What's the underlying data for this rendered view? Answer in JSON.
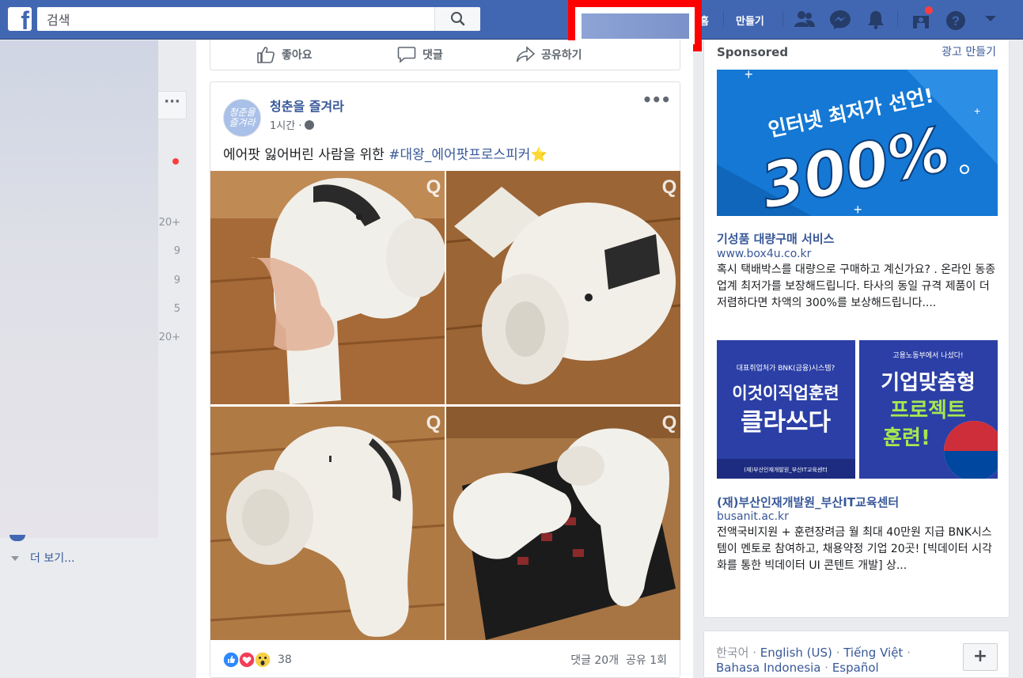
{
  "topbar": {
    "search_placeholder": "검색",
    "nav_home_partial": "홈",
    "nav_create": "만들기"
  },
  "left": {
    "counts": [
      "20+",
      "9",
      "9",
      "5",
      "20+"
    ],
    "see_more": "더 보기..."
  },
  "post_top_actions": {
    "like": "좋아요",
    "comment": "댓글",
    "share": "공유하기"
  },
  "post": {
    "page_name": "청춘을 즐겨라",
    "avatar_text": "청춘을 즐겨라",
    "time": "1시간 ·",
    "text_prefix": "에어팟 잃어버린 사람을 위한 ",
    "hashtag": "#대왕_에어팟프로스피커",
    "emoji": "⭐",
    "reaction_count": "38",
    "comments": "댓글 20개",
    "shares": "공유 1회"
  },
  "sidebar": {
    "sponsored": "Sponsored",
    "create_ad": "광고 만들기",
    "ad1": {
      "img_line1": "인터넷 최저가 선언!",
      "img_big": "300%",
      "title": "기성품 대량구매 서비스",
      "url": "www.box4u.co.kr",
      "desc": "혹시 택배박스를 대량으로 구매하고 계신가요? . 온라인 동종업계 최저가를 보장해드립니다. 타사의 동일 규격 제품이 더 저렴하다면 차액의 300%를 보상해드립니다...."
    },
    "ad2": {
      "imgA_top": "대표취업처가 BNK(금융)시스템?",
      "imgA_line1": "이것이직업훈련",
      "imgA_line2": "클라쓰다",
      "imgA_bottom": "(재)부산인재개발원_부산IT교육센터",
      "imgB_top": "고용노동부에서 나섰다!",
      "imgB_line1": "기업맞춤형",
      "imgB_line2": "프로젝트",
      "imgB_line3": "훈련!",
      "title": "(재)부산인재개발원_부산IT교육센터",
      "url": "busanit.ac.kr",
      "desc": "전액국비지원 + 훈련장려금 월 최대 40만원 지급 BNK시스템이 멘토로 참여하고, 채용약정 기업 20곳! [빅데이터 시각화를 통한 빅데이터 UI 콘텐트 개발] 상..."
    }
  },
  "languages": {
    "current": "한국어",
    "english": "English (US)",
    "vietnamese": "Tiếng Việt",
    "indonesian": "Bahasa Indonesia",
    "spanish": "Español",
    "add": "+"
  },
  "colors": {
    "brand": "#4267b2",
    "link": "#385898",
    "notification": "#fa3e3e"
  }
}
